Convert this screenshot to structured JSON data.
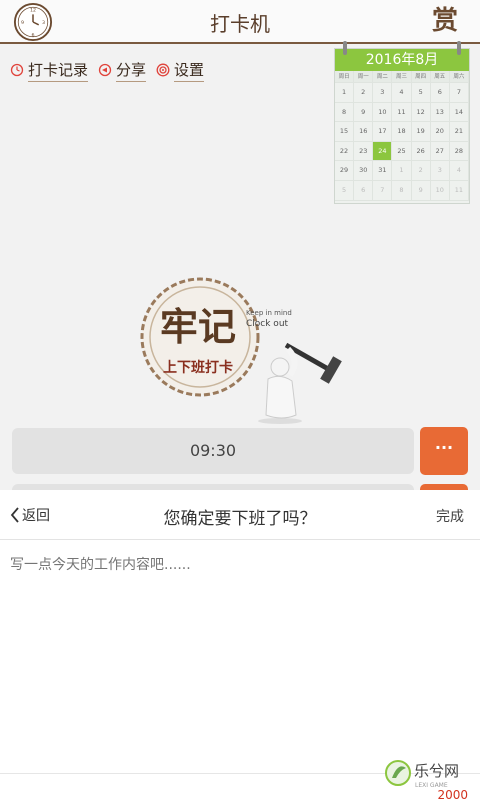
{
  "header": {
    "title": "打卡机",
    "reward_label": "赏"
  },
  "links": [
    {
      "label": "打卡记录",
      "icon": "history-icon"
    },
    {
      "label": "分享",
      "icon": "share-icon"
    },
    {
      "label": "设置",
      "icon": "settings-icon"
    }
  ],
  "calendar": {
    "title": "2016年8月",
    "weekdays": [
      "周日",
      "周一",
      "周二",
      "周三",
      "周四",
      "周五",
      "周六"
    ],
    "rows": [
      [
        "1",
        "2",
        "3",
        "4",
        "5",
        "6",
        "7"
      ],
      [
        "8",
        "9",
        "10",
        "11",
        "12",
        "13",
        "14"
      ],
      [
        "15",
        "16",
        "17",
        "18",
        "19",
        "20",
        "21"
      ],
      [
        "22",
        "23",
        "24",
        "25",
        "26",
        "27",
        "28"
      ],
      [
        "29",
        "30",
        "31",
        "1",
        "2",
        "3",
        "4"
      ],
      [
        "5",
        "6",
        "7",
        "8",
        "9",
        "10",
        "11"
      ]
    ],
    "today": "24",
    "accent": "#8cc63f"
  },
  "logo": {
    "big": "牢记",
    "sub": "上下班打卡",
    "en1": "Keep in mind",
    "en2": "Clock out"
  },
  "time": {
    "value": "09:30",
    "more_label": "···",
    "accent": "#e86a35"
  },
  "sheet": {
    "back_label": "返回",
    "title": "您确定要下班了吗？",
    "done_label": "完成",
    "placeholder": "写一点今天的工作内容吧......",
    "counter": "2000",
    "counter_color": "#d2331f"
  },
  "watermark": {
    "text": "乐兮网",
    "sub": "LEXI GAME"
  }
}
